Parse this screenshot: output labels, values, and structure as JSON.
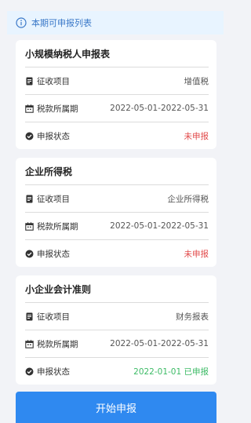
{
  "banner": {
    "text": "本期可申报列表"
  },
  "labels": {
    "item": "征收项目",
    "period": "税款所属期",
    "status": "申报状态"
  },
  "cards": [
    {
      "title": "小规模纳税人申报表",
      "item": "增值税",
      "period": "2022-05-01-2022-05-31",
      "status": "未申报",
      "status_color": "#e24b4b"
    },
    {
      "title": "企业所得税",
      "item": "企业所得税",
      "period": "2022-05-01-2022-05-31",
      "status": "未申报",
      "status_color": "#e24b4b"
    },
    {
      "title": "小企业会计准则",
      "item": "财务报表",
      "period": "2022-05-01-2022-05-31",
      "status": "2022-01-01 已申报",
      "status_color": "#3dbb66"
    }
  ],
  "submit_label": "开始申报"
}
